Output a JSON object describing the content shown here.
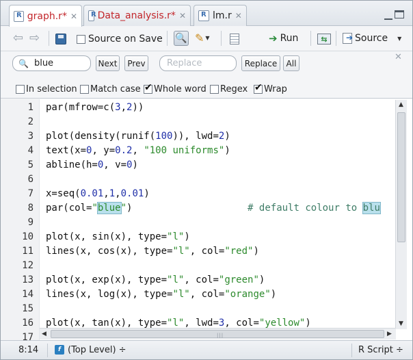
{
  "tabs": [
    {
      "label": "graph.r*",
      "modified": true,
      "active": true
    },
    {
      "label": "Data_analysis.r*",
      "modified": true,
      "active": false
    },
    {
      "label": "lm.r",
      "modified": false,
      "active": false
    }
  ],
  "toolbar": {
    "source_on_save_label": "Source on Save",
    "source_on_save_checked": false,
    "run_label": "Run",
    "source_label": "Source"
  },
  "find": {
    "search_value": "blue",
    "next_label": "Next",
    "prev_label": "Prev",
    "replace_placeholder": "Replace",
    "replace_button_label": "Replace",
    "all_label": "All",
    "options": [
      {
        "label": "In selection",
        "checked": false
      },
      {
        "label": "Match case",
        "checked": false
      },
      {
        "label": "Whole word",
        "checked": true
      },
      {
        "label": "Regex",
        "checked": false
      },
      {
        "label": "Wrap",
        "checked": true
      }
    ]
  },
  "editor": {
    "lines": [
      {
        "num": "1",
        "code": "par(mfrow=c(3,2))"
      },
      {
        "num": "2",
        "code": ""
      },
      {
        "num": "3",
        "code": "plot(density(runif(100)), lwd=2)"
      },
      {
        "num": "4",
        "code": "text(x=0, y=0.2, \"100 uniforms\")"
      },
      {
        "num": "5",
        "code": "abline(h=0, v=0)"
      },
      {
        "num": "6",
        "code": ""
      },
      {
        "num": "7",
        "code": "x=seq(0.01,1,0.01)"
      },
      {
        "num": "8",
        "code": "par(col=\"blue\")                    # default colour to blu"
      },
      {
        "num": "9",
        "code": ""
      },
      {
        "num": "10",
        "code": "plot(x, sin(x), type=\"l\")"
      },
      {
        "num": "11",
        "code": "lines(x, cos(x), type=\"l\", col=\"red\")"
      },
      {
        "num": "12",
        "code": ""
      },
      {
        "num": "13",
        "code": "plot(x, exp(x), type=\"l\", col=\"green\")"
      },
      {
        "num": "14",
        "code": "lines(x, log(x), type=\"l\", col=\"orange\")"
      },
      {
        "num": "15",
        "code": ""
      },
      {
        "num": "16",
        "code": "plot(x, tan(x), type=\"l\", lwd=3, col=\"yellow\")"
      },
      {
        "num": "17",
        "code": ""
      }
    ]
  },
  "status": {
    "position": "8:14",
    "scope": "(Top Level) ÷",
    "language": "R Script ÷"
  },
  "colors": {
    "modified_tab": "#c2262b",
    "number": "#1f2fa8",
    "string": "#2c8a2c",
    "comment": "#3e7c66",
    "highlight": "#b9e0ec"
  }
}
